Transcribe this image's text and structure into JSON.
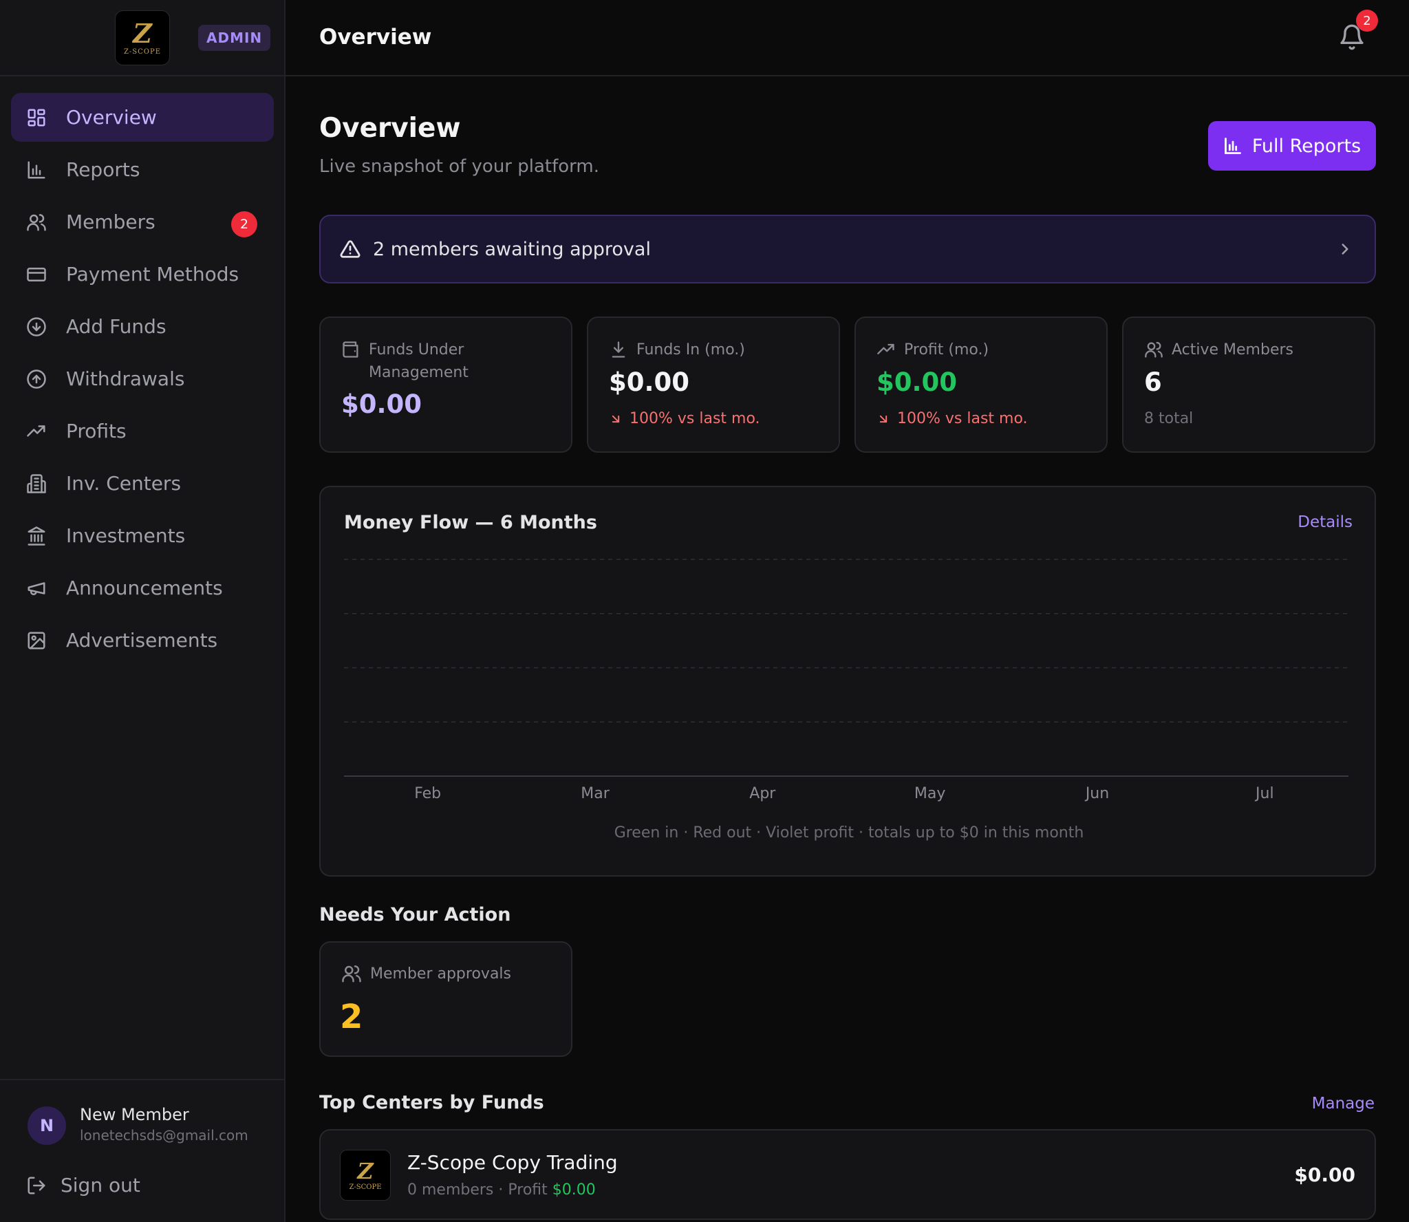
{
  "brand": {
    "logo_mark": "Z",
    "logo_text": "Z-SCOPE",
    "role_badge": "ADMIN"
  },
  "sidebar": {
    "items": [
      {
        "label": "Overview",
        "icon": "grid-icon",
        "active": true
      },
      {
        "label": "Reports",
        "icon": "bar-chart-icon"
      },
      {
        "label": "Members",
        "icon": "users-icon",
        "badge": "2"
      },
      {
        "label": "Payment Methods",
        "icon": "credit-card-icon"
      },
      {
        "label": "Add Funds",
        "icon": "arrow-down-circle-icon"
      },
      {
        "label": "Withdrawals",
        "icon": "arrow-up-circle-icon"
      },
      {
        "label": "Profits",
        "icon": "trending-up-icon"
      },
      {
        "label": "Inv. Centers",
        "icon": "building-icon"
      },
      {
        "label": "Investments",
        "icon": "bank-icon"
      },
      {
        "label": "Announcements",
        "icon": "megaphone-icon"
      },
      {
        "label": "Advertisements",
        "icon": "image-icon"
      }
    ]
  },
  "user": {
    "initial": "N",
    "name": "New Member",
    "email": "lonetechsds@gmail.com",
    "signout_label": "Sign out"
  },
  "topbar": {
    "title": "Overview",
    "notification_count": "2"
  },
  "header": {
    "title": "Overview",
    "subtitle": "Live snapshot of your platform.",
    "full_reports_label": "Full Reports"
  },
  "alert": {
    "text": "2 members awaiting approval"
  },
  "stats": [
    {
      "label": "Funds Under Management",
      "value": "$0.00",
      "color": "#c4b5fd"
    },
    {
      "label": "Funds In (mo.)",
      "value": "$0.00",
      "trend": "100% vs last mo.",
      "color": "#f4f4f5"
    },
    {
      "label": "Profit (mo.)",
      "value": "$0.00",
      "trend": "100% vs last mo.",
      "color": "#22c55e"
    },
    {
      "label": "Active Members",
      "value": "6",
      "sub": "8 total",
      "color": "#f4f4f5"
    }
  ],
  "chart": {
    "title": "Money Flow — 6 Months",
    "details_label": "Details",
    "footnote": "Green in · Red out · Violet profit · totals up to $0 in this month"
  },
  "chart_data": {
    "type": "bar",
    "categories": [
      "Feb",
      "Mar",
      "Apr",
      "May",
      "Jun",
      "Jul"
    ],
    "series": [
      {
        "values": [
          0,
          0,
          0,
          0,
          0,
          0
        ],
        "color": "#22c55e"
      },
      {
        "values": [
          0,
          0,
          0,
          0,
          0,
          0
        ],
        "color": "#ef4444"
      },
      {
        "values": [
          0,
          0,
          0,
          0,
          0,
          0
        ],
        "color": "#8b5cf6"
      }
    ],
    "title": "Money Flow — 6 Months",
    "grid": true
  },
  "needs_action": {
    "title": "Needs Your Action",
    "card_label": "Member approvals",
    "card_value": "2"
  },
  "top_centers": {
    "title": "Top Centers by Funds",
    "manage_label": "Manage",
    "rows": [
      {
        "name": "Z-Scope Copy Trading",
        "meta_prefix": "0 members · Profit ",
        "profit": "$0.00",
        "amount": "$0.00"
      }
    ]
  }
}
